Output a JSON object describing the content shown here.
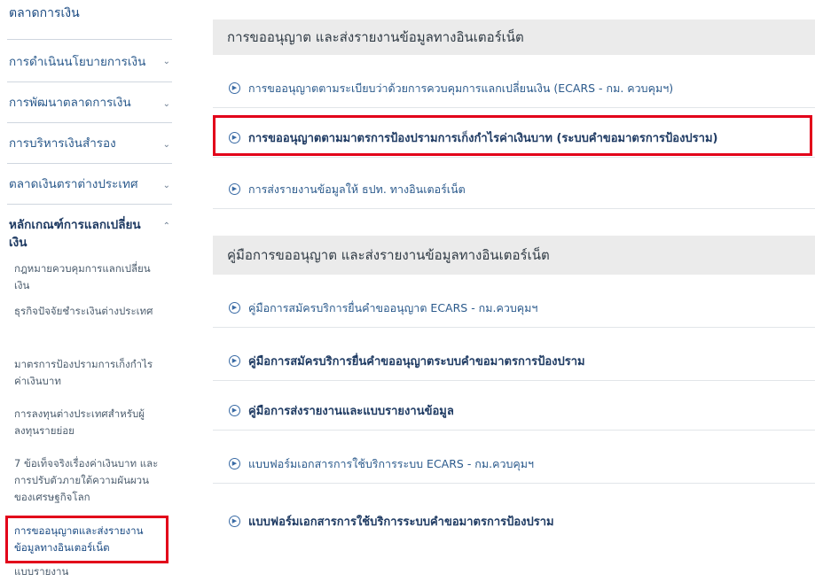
{
  "sidebar": {
    "title": "ตลาดการเงิน",
    "items": [
      {
        "label": "การดำเนินนโยบายการเงิน",
        "chevron": "⌄"
      },
      {
        "label": "การพัฒนาตลาดการเงิน",
        "chevron": "⌄"
      },
      {
        "label": "การบริหารเงินสำรอง",
        "chevron": "⌄"
      },
      {
        "label": "ตลาดเงินตราต่างประเทศ",
        "chevron": "⌄"
      },
      {
        "label": "หลักเกณฑ์การแลกเปลี่ยนเงิน",
        "chevron": "⌃"
      }
    ],
    "subitems": [
      "กฎหมายควบคุมการแลกเปลี่ยนเงิน",
      "ธุรกิจปัจจัยชำระเงินต่างประเทศ",
      "มาตรการป้องปรามการเก็งกำไรค่าเงินบาท",
      "การลงทุนต่างประเทศสำหรับผู้ลงทุนรายย่อย",
      "7 ข้อเท็จจริงเรื่องค่าเงินบาท และการปรับตัวภายใต้ความผันผวนของเศรษฐกิจโลก",
      "การขออนุญาตและส่งรายงานข้อมูลทางอินเตอร์เน็ต",
      "แบบรายงาน"
    ]
  },
  "sections": [
    {
      "header": "การขออนุญาต และส่งรายงานข้อมูลทางอินเตอร์เน็ต",
      "links": [
        "การขออนุญาตตามระเบียบว่าด้วยการควบคุมการแลกเปลี่ยนเงิน (ECARS - กม. ควบคุมฯ)",
        "การขออนุญาตตามมาตรการป้องปรามการเก็งกำไรค่าเงินบาท (ระบบคำขอมาตรการป้องปราม)",
        "การส่งรายงานข้อมูลให้ ธปท. ทางอินเตอร์เน็ต"
      ]
    },
    {
      "header": "คู่มือการขออนุญาต และส่งรายงานข้อมูลทางอินเตอร์เน็ต",
      "links": [
        "คู่มือการสมัครบริการยื่นคำขออนุญาต ECARS - กม.ควบคุมฯ",
        "คู่มือการสมัครบริการยื่นคำขออนุญาตระบบคำขอมาตรการป้องปราม",
        "คู่มือการส่งรายงานและแบบรายงานข้อมูล",
        "แบบฟอร์มเอกสารการใช้บริการระบบ ECARS - กม.ควบคุมฯ",
        "แบบฟอร์มเอกสารการใช้บริการระบบคำขอมาตรการป้องปราม"
      ]
    }
  ],
  "colors": {
    "highlight": "#e2001a",
    "link": "#2b5a8c",
    "header_bg": "#ebebeb"
  }
}
